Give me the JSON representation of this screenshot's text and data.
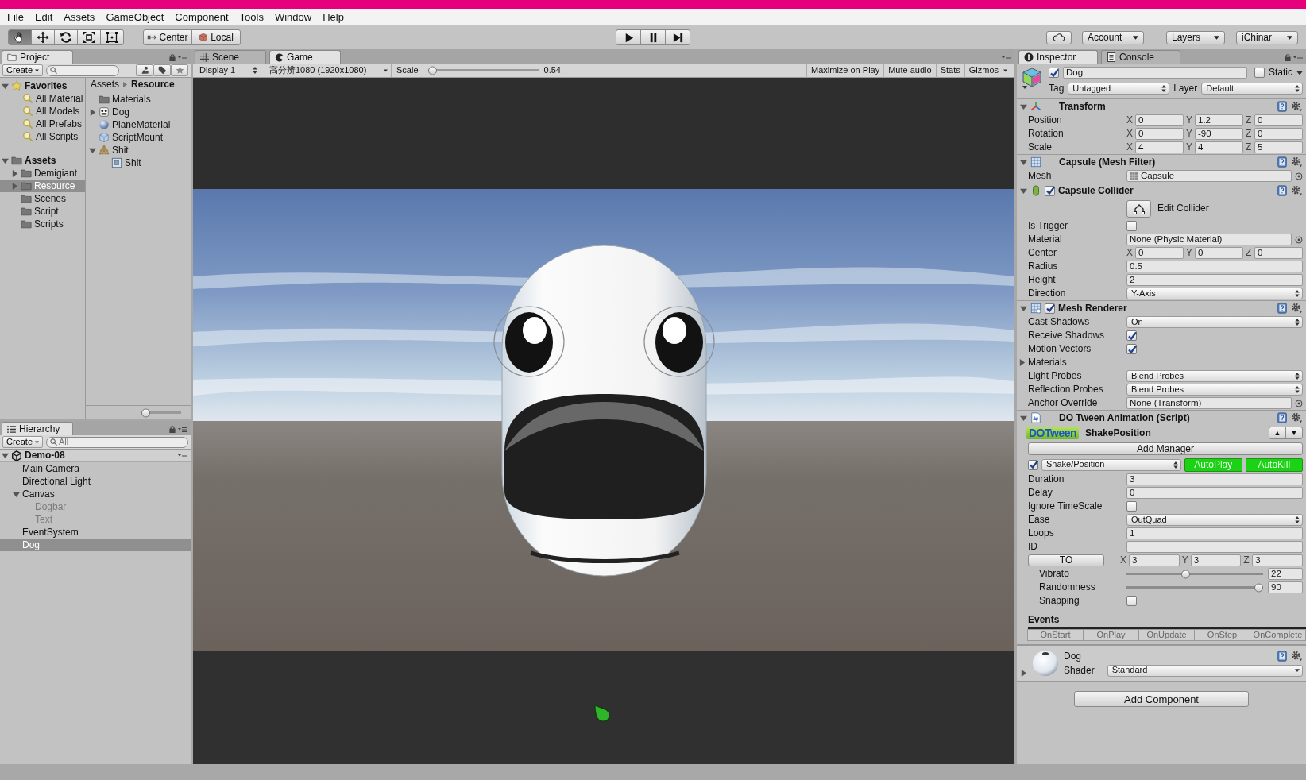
{
  "menu": [
    "File",
    "Edit",
    "Assets",
    "GameObject",
    "Component",
    "Tools",
    "Window",
    "Help"
  ],
  "toolbar": {
    "tools": [
      {
        "kind": "hand",
        "selected": true
      },
      {
        "kind": "move",
        "selected": false
      },
      {
        "kind": "rotate",
        "selected": false
      },
      {
        "kind": "scale",
        "selected": false
      },
      {
        "kind": "rect",
        "selected": false
      }
    ],
    "pivot": [
      {
        "kind": "pivot",
        "label": "Center"
      },
      {
        "kind": "space",
        "label": "Local"
      }
    ],
    "menus": [
      "Account",
      "Layers",
      "iChinar"
    ]
  },
  "project": {
    "tab": "Project",
    "create": "Create",
    "favorites": {
      "label": "Favorites",
      "expanded": true,
      "items": [
        "All Material",
        "All Models",
        "All Prefabs",
        "All Scripts"
      ]
    },
    "assets": {
      "label": "Assets",
      "expanded": true,
      "children": [
        {
          "label": "Demigiant",
          "expanded": false,
          "selected": false
        },
        {
          "label": "Resource",
          "expanded": false,
          "selected": true
        },
        {
          "label": "Scenes",
          "selected": false
        },
        {
          "label": "Script",
          "selected": false
        },
        {
          "label": "Scripts",
          "selected": false
        }
      ]
    },
    "breadcrumb": [
      "Assets",
      "Resource"
    ],
    "zoom": {
      "level": 0
    },
    "files": [
      {
        "label": "Materials",
        "kind": "folder"
      },
      {
        "label": "Dog",
        "kind": "prefab",
        "expanded": false
      },
      {
        "label": "PlaneMaterial",
        "kind": "material"
      },
      {
        "label": "ScriptMount",
        "kind": "script"
      },
      {
        "label": "Shit",
        "kind": "model",
        "expanded": true,
        "children": [
          {
            "label": "Shit",
            "kind": "mesh"
          }
        ]
      }
    ]
  },
  "hierarchy": {
    "tab": "Hierarchy",
    "create": "Create",
    "search_placeholder": "All",
    "scene": {
      "label": "Demo-08",
      "expanded": true
    },
    "items": [
      {
        "label": "Main Camera",
        "selected": false,
        "active": true
      },
      {
        "label": "Directional Light",
        "selected": false,
        "active": true
      },
      {
        "label": "Canvas",
        "selected": false,
        "active": true,
        "expanded": true,
        "children": [
          {
            "label": "Dogbar",
            "selected": false,
            "active": false
          },
          {
            "label": "Text",
            "selected": false,
            "active": false
          }
        ]
      },
      {
        "label": "EventSystem",
        "selected": false,
        "active": true
      },
      {
        "label": "Dog",
        "selected": true,
        "active": true
      }
    ]
  },
  "game": {
    "tabs": [
      {
        "label": "Scene",
        "kind": "scene",
        "selected": false
      },
      {
        "label": "Game",
        "kind": "game",
        "selected": true
      }
    ],
    "display": "Display 1",
    "resolution": "高分辨1080 (1920x1080)",
    "scale": {
      "label": "Scale",
      "level": 0,
      "reading": "0.54:"
    },
    "options": [
      "Maximize on Play",
      "Mute audio",
      "Stats",
      "Gizmos"
    ]
  },
  "inspector": {
    "tabs": [
      {
        "label": "Inspector",
        "kind": "inspector",
        "selected": true
      },
      {
        "label": "Console",
        "kind": "console",
        "selected": false
      }
    ],
    "object": {
      "active": true,
      "name": "Dog",
      "static_label": "Static",
      "static": false,
      "tag_label": "Tag",
      "tag": "Untagged",
      "layer_label": "Layer",
      "layer": "Default"
    },
    "components": [
      {
        "kind": "transform",
        "title": "Transform",
        "expanded": true,
        "rows": [
          {
            "label": "Position",
            "kind": "vector",
            "values": [
              {
                "axis": "X",
                "value": "0"
              },
              {
                "axis": "Y",
                "value": "1.2"
              },
              {
                "axis": "Z",
                "value": "0"
              }
            ]
          },
          {
            "label": "Rotation",
            "kind": "vector",
            "values": [
              {
                "axis": "X",
                "value": "0"
              },
              {
                "axis": "Y",
                "value": "-90"
              },
              {
                "axis": "Z",
                "value": "0"
              }
            ]
          },
          {
            "label": "Scale",
            "kind": "vector",
            "values": [
              {
                "axis": "X",
                "value": "4"
              },
              {
                "axis": "Y",
                "value": "4"
              },
              {
                "axis": "Z",
                "value": "5"
              }
            ]
          }
        ]
      },
      {
        "kind": "mesh_filter",
        "title": "Capsule (Mesh Filter)",
        "expanded": true,
        "rows": [
          {
            "label": "Mesh",
            "kind": "mesh_object",
            "value": "Capsule"
          }
        ]
      },
      {
        "kind": "collider",
        "title": "Capsule Collider",
        "expanded": true,
        "enabled": true,
        "rows": [
          {
            "kind": "edit_button",
            "label": "Edit Collider"
          },
          {
            "label": "Is Trigger",
            "kind": "checkbox",
            "checked": false
          },
          {
            "label": "Material",
            "kind": "object",
            "value": "None (Physic Material)"
          },
          {
            "label": "Center",
            "kind": "vector",
            "values": [
              {
                "axis": "X",
                "value": "0"
              },
              {
                "axis": "Y",
                "value": "0"
              },
              {
                "axis": "Z",
                "value": "0"
              }
            ]
          },
          {
            "label": "Radius",
            "kind": "text",
            "value": "0.5"
          },
          {
            "label": "Height",
            "kind": "text",
            "value": "2"
          },
          {
            "label": "Direction",
            "kind": "dropdown",
            "value": "Y-Axis"
          }
        ]
      },
      {
        "kind": "renderer",
        "title": "Mesh Renderer",
        "expanded": true,
        "enabled": true,
        "rows": [
          {
            "label": "Cast Shadows",
            "kind": "dropdown",
            "value": "On"
          },
          {
            "label": "Receive Shadows",
            "kind": "checkbox",
            "checked": true
          },
          {
            "label": "Motion Vectors",
            "kind": "checkbox",
            "checked": true
          },
          {
            "label": "Materials",
            "kind": "foldout",
            "expanded": false
          },
          {
            "label": "Light Probes",
            "kind": "dropdown",
            "value": "Blend Probes"
          },
          {
            "label": "Reflection Probes",
            "kind": "dropdown",
            "value": "Blend Probes"
          },
          {
            "label": "Anchor Override",
            "kind": "object",
            "value": "None (Transform)"
          }
        ]
      },
      {
        "kind": "tween",
        "title": "DO Tween Animation (Script)",
        "expanded": true,
        "logo": "DOTween",
        "animation": "ShakePosition",
        "order_buttons": [
          "▲",
          "▼"
        ],
        "add_manager": "Add Manager",
        "tween_enabled": true,
        "type": "Shake/Position",
        "toggles": [
          {
            "label": "AutoPlay",
            "on": true
          },
          {
            "label": "AutoKill",
            "on": true
          }
        ],
        "rows": [
          {
            "label": "Duration",
            "kind": "text",
            "value": "3"
          },
          {
            "label": "Delay",
            "kind": "text",
            "value": "0"
          },
          {
            "label": "Ignore TimeScale",
            "kind": "checkbox",
            "checked": false
          },
          {
            "label": "Ease",
            "kind": "dropdown",
            "value": "OutQuad"
          },
          {
            "label": "Loops",
            "kind": "text",
            "value": "1"
          },
          {
            "label": "ID",
            "kind": "text"
          },
          {
            "button": "TO",
            "kind": "button_vector",
            "values": [
              {
                "axis": "X",
                "value": "3"
              },
              {
                "axis": "Y",
                "value": "3"
              },
              {
                "axis": "Z",
                "value": "3"
              }
            ],
            "children": [
              {
                "label": "Vibrato",
                "kind": "slider",
                "level": 0.43,
                "value": "22"
              },
              {
                "label": "Randomness",
                "kind": "slider",
                "level": 1,
                "value": "90"
              },
              {
                "label": "Snapping",
                "kind": "checkbox",
                "checked": false
              }
            ]
          }
        ],
        "events": {
          "label": "Events",
          "tabs": [
            {
              "label": "OnStart",
              "selected": false
            },
            {
              "label": "OnPlay",
              "selected": false
            },
            {
              "label": "OnUpdate",
              "selected": false
            },
            {
              "label": "OnStep",
              "selected": false
            },
            {
              "label": "OnComplete",
              "selected": false
            }
          ]
        }
      },
      {
        "kind": "material",
        "title": "Dog",
        "expanded": false,
        "shader_label": "Shader",
        "shader": "Standard"
      }
    ],
    "add_component": "Add Component"
  }
}
